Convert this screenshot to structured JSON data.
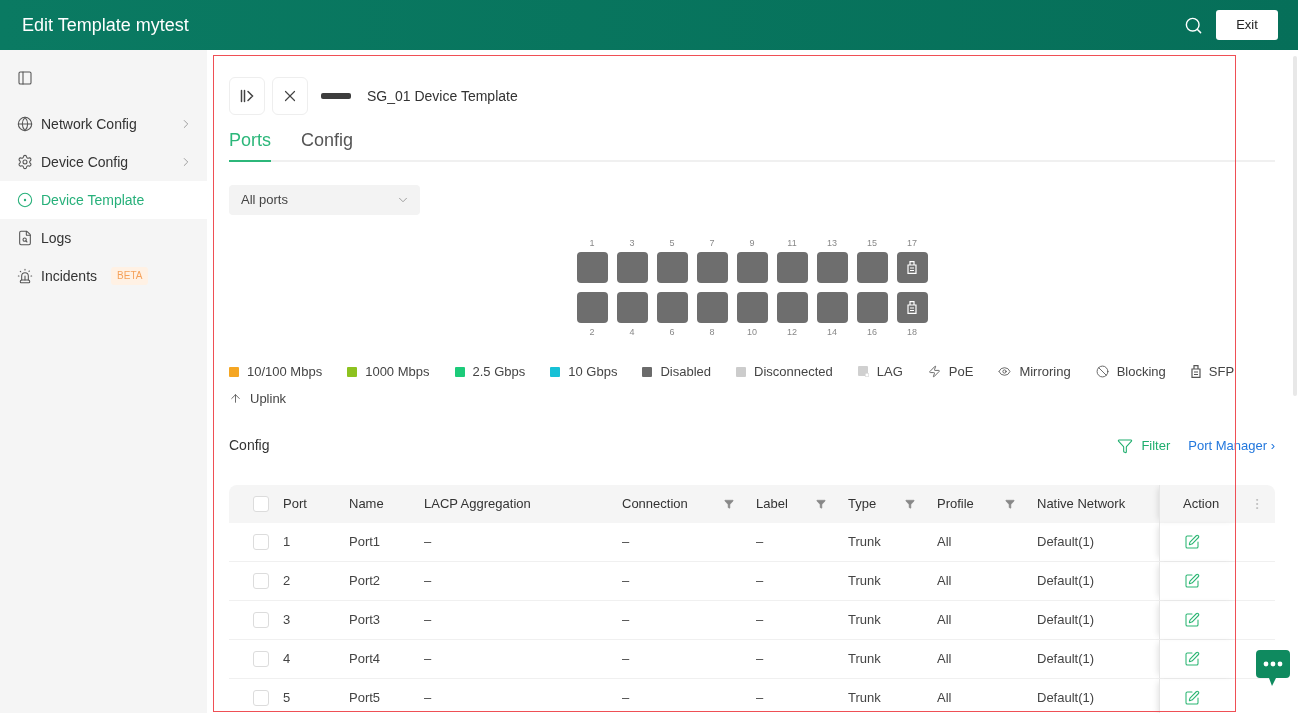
{
  "window": {
    "title": "Edit Template mytest"
  },
  "header": {
    "exit_button": "Exit"
  },
  "sidebar": {
    "items": [
      {
        "label": "Network Config",
        "kind": "group",
        "selected": false
      },
      {
        "label": "Device Config",
        "kind": "group",
        "selected": false
      },
      {
        "label": "Device Template",
        "kind": "link",
        "selected": true
      },
      {
        "label": "Logs",
        "kind": "link",
        "selected": false
      },
      {
        "label": "Incidents",
        "kind": "link",
        "selected": false,
        "badge": "BETA"
      }
    ]
  },
  "device": {
    "title": "SG_01 Device Template"
  },
  "tabs": [
    {
      "label": "Ports",
      "selected": true
    },
    {
      "label": "Config",
      "selected": false
    }
  ],
  "port_filter": {
    "value": "All ports"
  },
  "port_panel": {
    "top_row": [
      {
        "label": "1",
        "kind": "rj45",
        "color": "#6e6e6e"
      },
      {
        "label": "3",
        "kind": "rj45",
        "color": "#6e6e6e"
      },
      {
        "label": "5",
        "kind": "rj45",
        "color": "#6e6e6e"
      },
      {
        "label": "7",
        "kind": "rj45",
        "color": "#6e6e6e"
      },
      {
        "label": "9",
        "kind": "rj45",
        "color": "#6e6e6e"
      },
      {
        "label": "11",
        "kind": "rj45",
        "color": "#6e6e6e"
      },
      {
        "label": "13",
        "kind": "rj45",
        "color": "#6e6e6e"
      },
      {
        "label": "15",
        "kind": "rj45",
        "color": "#6e6e6e"
      },
      {
        "label": "17",
        "kind": "sfp",
        "color": "#6e6e6e"
      }
    ],
    "bottom_row": [
      {
        "label": "2",
        "kind": "rj45",
        "color": "#6e6e6e"
      },
      {
        "label": "4",
        "kind": "rj45",
        "color": "#6e6e6e"
      },
      {
        "label": "6",
        "kind": "rj45",
        "color": "#6e6e6e"
      },
      {
        "label": "8",
        "kind": "rj45",
        "color": "#6e6e6e"
      },
      {
        "label": "10",
        "kind": "rj45",
        "color": "#6e6e6e"
      },
      {
        "label": "12",
        "kind": "rj45",
        "color": "#6e6e6e"
      },
      {
        "label": "14",
        "kind": "rj45",
        "color": "#6e6e6e"
      },
      {
        "label": "16",
        "kind": "rj45",
        "color": "#6e6e6e"
      },
      {
        "label": "18",
        "kind": "sfp",
        "color": "#6e6e6e"
      }
    ]
  },
  "legend": [
    {
      "label": "10/100 Mbps",
      "kind": "swatch",
      "color": "#f5a623"
    },
    {
      "label": "1000 Mbps",
      "kind": "swatch",
      "color": "#8dc21f"
    },
    {
      "label": "2.5 Gbps",
      "kind": "swatch",
      "color": "#1ccb7a"
    },
    {
      "label": "10 Gbps",
      "kind": "swatch",
      "color": "#17c1d6"
    },
    {
      "label": "Disabled",
      "kind": "swatch",
      "color": "#6b6b6b"
    },
    {
      "label": "Disconnected",
      "kind": "swatch",
      "color": "#cccccc"
    },
    {
      "label": "LAG",
      "kind": "lag"
    },
    {
      "label": "PoE",
      "kind": "poe"
    },
    {
      "label": "Mirroring",
      "kind": "mirroring"
    },
    {
      "label": "Blocking",
      "kind": "blocking"
    },
    {
      "label": "SFP",
      "kind": "sfp"
    },
    {
      "label": "Uplink",
      "kind": "uplink"
    }
  ],
  "config_section": {
    "title": "Config",
    "filter_link": "Filter",
    "port_manager_link": "Port Manager ›"
  },
  "table": {
    "select_all": {
      "checked": false
    },
    "columns": [
      {
        "label": "Port",
        "filterable": false
      },
      {
        "label": "Name",
        "filterable": false
      },
      {
        "label": "LACP Aggregation",
        "filterable": false
      },
      {
        "label": "Connection",
        "filterable": true
      },
      {
        "label": "Label",
        "filterable": true
      },
      {
        "label": "Type",
        "filterable": true
      },
      {
        "label": "Profile",
        "filterable": true
      },
      {
        "label": "Native Network",
        "filterable": false
      }
    ],
    "action_column": {
      "label": "Action"
    },
    "rows": [
      {
        "checked": false,
        "cells": [
          "1",
          "Port1",
          "–",
          "–",
          "–",
          "Trunk",
          "All",
          "Default(1)"
        ]
      },
      {
        "checked": false,
        "cells": [
          "2",
          "Port2",
          "–",
          "–",
          "–",
          "Trunk",
          "All",
          "Default(1)"
        ]
      },
      {
        "checked": false,
        "cells": [
          "3",
          "Port3",
          "–",
          "–",
          "–",
          "Trunk",
          "All",
          "Default(1)"
        ]
      },
      {
        "checked": false,
        "cells": [
          "4",
          "Port4",
          "–",
          "–",
          "–",
          "Trunk",
          "All",
          "Default(1)"
        ]
      },
      {
        "checked": false,
        "cells": [
          "5",
          "Port5",
          "–",
          "–",
          "–",
          "Trunk",
          "All",
          "Default(1)"
        ]
      }
    ]
  }
}
